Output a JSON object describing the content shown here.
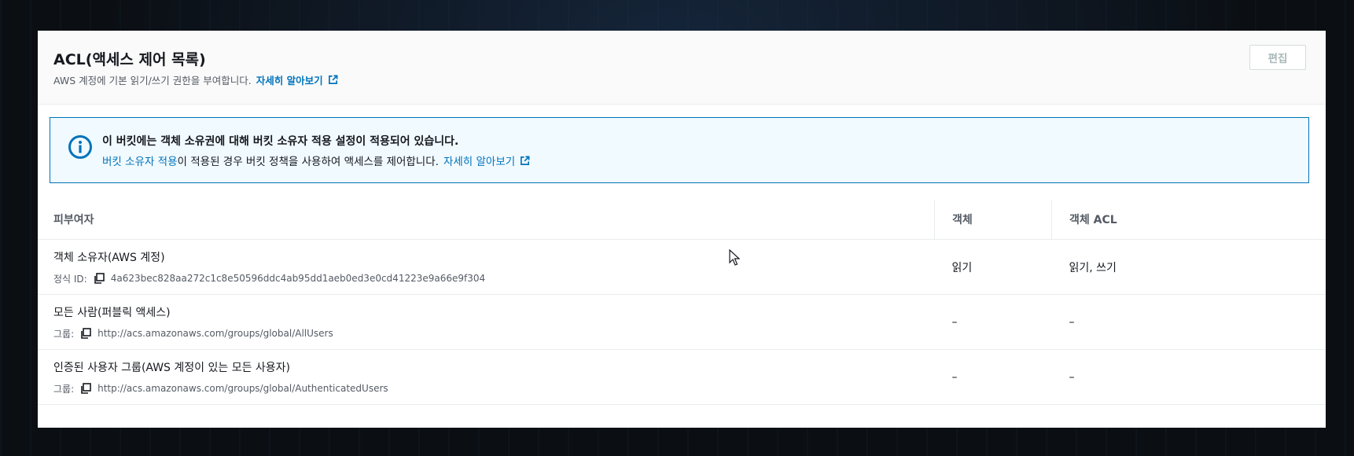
{
  "panel": {
    "title": "ACL(액세스 제어 목록)",
    "subtitle": "AWS 계정에 기본 읽기/쓰기 권한을 부여합니다.",
    "learn_more": "자세히 알아보기",
    "edit_label": "편집"
  },
  "alert": {
    "title": "이 버킷에는 객체 소유권에 대해 버킷 소유자 적용 설정이 적용되어 있습니다.",
    "body_link": "버킷 소유자 적용",
    "body_text": "이 적용된 경우 버킷 정책을 사용하여 액세스를 제어합니다.",
    "learn_more": "자세히 알아보기"
  },
  "table": {
    "headers": [
      "피부여자",
      "객체",
      "객체 ACL"
    ],
    "rows": [
      {
        "grantee": "객체 소유자(AWS 계정)",
        "id_label": "정식 ID:",
        "id_value": "4a623bec828aa272c1c8e50596ddc4ab95dd1aeb0ed3e0cd41223e9a66e9f304",
        "object": "읽기",
        "object_acl": "읽기, 쓰기"
      },
      {
        "grantee": "모든 사람(퍼블릭 액세스)",
        "id_label": "그룹:",
        "id_value": "http://acs.amazonaws.com/groups/global/AllUsers",
        "object": "–",
        "object_acl": "–"
      },
      {
        "grantee": "인증된 사용자 그룹(AWS 계정이 있는 모든 사용자)",
        "id_label": "그룹:",
        "id_value": "http://acs.amazonaws.com/groups/global/AuthenticatedUsers",
        "object": "–",
        "object_acl": "–"
      }
    ]
  },
  "colors": {
    "link": "#0073bb",
    "alert_border": "#0073bb",
    "alert_bg": "#f1faff"
  }
}
